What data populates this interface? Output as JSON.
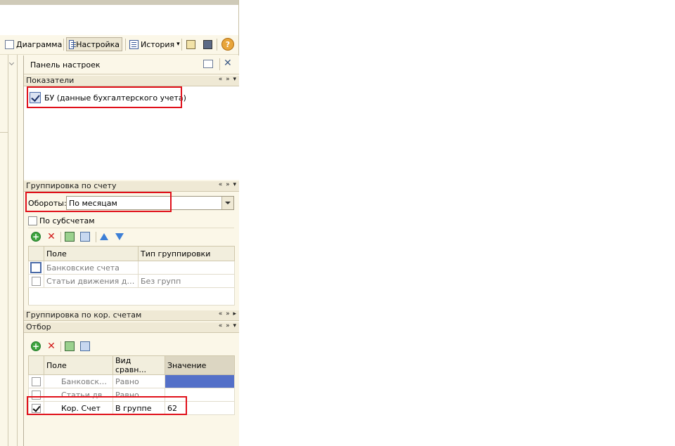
{
  "toolbar": {
    "diagram_label": "Диаграмма",
    "settings_label": "Настройка",
    "history_label": "История",
    "history_arrow": "▾",
    "help_label": "?"
  },
  "panel": {
    "title": "Панель настроек",
    "close": "✕"
  },
  "sections": {
    "indicators": {
      "title": "Показатели",
      "controls": "« » ▾"
    },
    "grouping_account": {
      "title": "Группировка по счету",
      "controls": "« » ▾"
    },
    "grouping_corr": {
      "title": "Группировка по кор. счетам",
      "controls": "« » ▸"
    },
    "filter": {
      "title": "Отбор",
      "controls": "« » ▾"
    }
  },
  "indicators": {
    "bu_label": "БУ (данные бухгалтерского учета)",
    "bu_checked": true
  },
  "grouping": {
    "turnover_label": "Обороты:",
    "turnover_value": "По месяцам",
    "subaccounts_label": "По субсчетам",
    "columns": [
      "Поле",
      "Тип группировки"
    ],
    "rows": [
      {
        "field": "Банковские счета",
        "type": ""
      },
      {
        "field": "Статьи движения дене...",
        "type": "Без групп"
      }
    ]
  },
  "filter": {
    "columns": [
      "Поле",
      "Вид сравн...",
      "Значение"
    ],
    "rows": [
      {
        "field": "Банковски...",
        "comparison": "Равно",
        "value": "",
        "checked": false
      },
      {
        "field": "Статьи дви...",
        "comparison": "Равно",
        "value": "",
        "checked": false
      },
      {
        "field": "Кор. Счет",
        "comparison": "В группе",
        "value": "62",
        "checked": true
      }
    ]
  }
}
